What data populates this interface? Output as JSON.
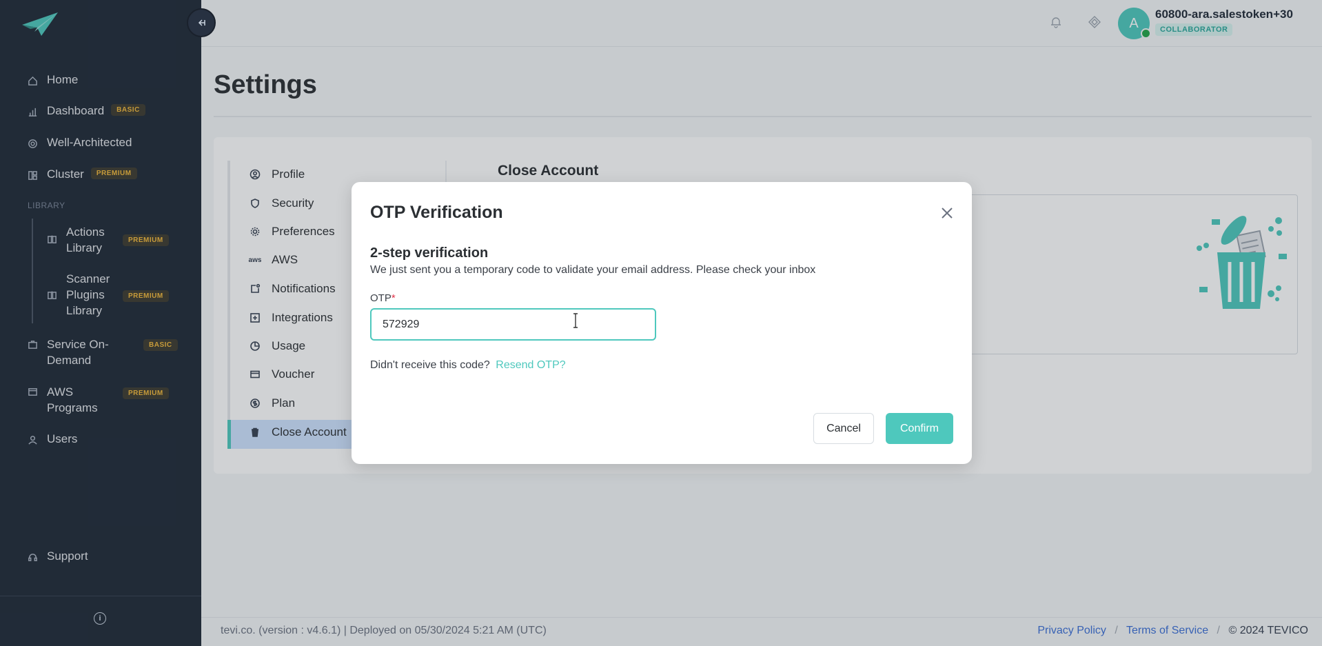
{
  "sidebar": {
    "logo_icon": "paper-plane-logo",
    "collapse_icon": "collapse-left-icon",
    "items": [
      {
        "label": "Home",
        "icon": "home-icon"
      },
      {
        "label": "Dashboard",
        "icon": "bar-chart-icon",
        "badge": "BASIC"
      },
      {
        "label": "Well-Architected",
        "icon": "target-icon"
      },
      {
        "label": "Cluster",
        "icon": "cluster-icon",
        "badge": "PREMIUM"
      }
    ],
    "library_label": "LIBRARY",
    "library_items": [
      {
        "label_lines": [
          "Actions",
          "Library"
        ],
        "icon": "book-icon",
        "badge": "PREMIUM"
      },
      {
        "label_lines": [
          "Scanner",
          "Plugins",
          "Library"
        ],
        "icon": "book-icon",
        "badge": "PREMIUM"
      }
    ],
    "items2": [
      {
        "label_lines": [
          "Service On-",
          "Demand"
        ],
        "icon": "briefcase-icon",
        "badge": "BASIC"
      },
      {
        "label_lines": [
          "AWS",
          "Programs"
        ],
        "icon": "cards-icon",
        "badge": "PREMIUM"
      },
      {
        "label": "Users",
        "icon": "user-icon"
      }
    ],
    "support_label": "Support",
    "info_label": "i"
  },
  "topbar": {
    "username": "60800-ara.salestoken+30",
    "role": "COLLABORATOR",
    "avatar_initial": "A"
  },
  "page": {
    "title": "Settings"
  },
  "settings_nav": {
    "items": [
      {
        "label": "Profile",
        "icon": "user-circle-icon"
      },
      {
        "label": "Security",
        "icon": "shield-icon"
      },
      {
        "label": "Preferences",
        "icon": "gear-icon"
      },
      {
        "label": "AWS",
        "icon": "aws-icon"
      },
      {
        "label": "Notifications",
        "icon": "notification-icon"
      },
      {
        "label": "Integrations",
        "icon": "plus-square-icon"
      },
      {
        "label": "Usage",
        "icon": "pie-chart-icon"
      },
      {
        "label": "Voucher",
        "icon": "card-icon"
      },
      {
        "label": "Plan",
        "icon": "dollar-circle-icon"
      },
      {
        "label": "Close Account",
        "icon": "trash-icon"
      }
    ],
    "active": "Close Account"
  },
  "close_account": {
    "title": "Close Account"
  },
  "modal": {
    "title": "OTP Verification",
    "step_title": "2-step verification",
    "step_desc": "We just sent you a temporary code to validate your email address. Please check your inbox",
    "otp_label": "OTP",
    "otp_required": "*",
    "otp_value": "572929",
    "resend_prompt": "Didn't receive this code?",
    "resend_link": "Resend OTP?",
    "cancel_label": "Cancel",
    "confirm_label": "Confirm"
  },
  "footer": {
    "left": "tevi.co. (version : v4.6.1) | Deployed on 05/30/2024 5:21 AM (UTC)",
    "privacy": "Privacy Policy",
    "terms": "Terms of Service",
    "copyright": "© 2024 TEVICO",
    "separator": "/"
  },
  "colors": {
    "accent": "#4ec8bd",
    "sidebar_bg": "#1f2937",
    "badge_text": "#f4b93a",
    "link": "#3b6fd6"
  }
}
